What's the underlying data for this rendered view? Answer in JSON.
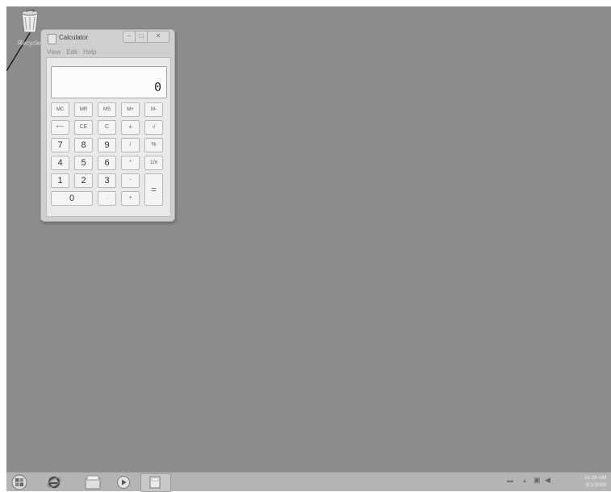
{
  "desktop": {
    "recycle_bin_label": "Recycle Bin"
  },
  "calculator": {
    "title": "Calculator",
    "menu": [
      "View",
      "Edit",
      "Help"
    ],
    "display_value": "0",
    "memory_keys": [
      "MC",
      "MR",
      "MS",
      "M+",
      "M-"
    ],
    "row2_keys": [
      "⟵",
      "CE",
      "C",
      "±",
      "√"
    ],
    "row3_keys": [
      "7",
      "8",
      "9",
      "/",
      "%"
    ],
    "row4_keys": [
      "4",
      "5",
      "6",
      "*",
      "1/x"
    ],
    "row5_keys": [
      "1",
      "2",
      "3",
      "-"
    ],
    "row6_keys": [
      "0",
      ".",
      "+"
    ],
    "equals_key": "="
  },
  "taskbar": {
    "clock_time": "11:28 AM",
    "clock_date": "9/1/2009"
  }
}
